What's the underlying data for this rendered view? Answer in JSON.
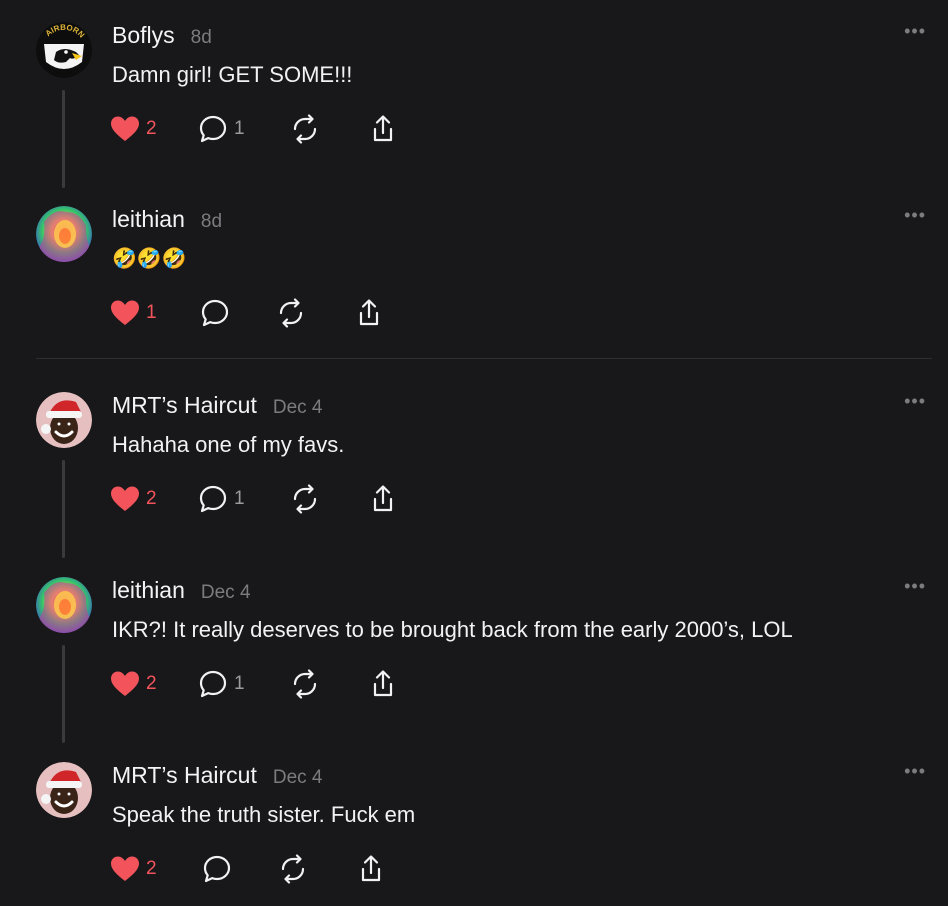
{
  "posts": [
    {
      "username": "Boflys",
      "time": "8d",
      "text": "Damn girl! GET SOME!!!",
      "likes": "2",
      "replies": "1",
      "avatar": "airborne-eagle-avatar",
      "avatar_text": "AIRBORNE"
    },
    {
      "username": "leithian",
      "time": "8d",
      "text": "🤣🤣🤣",
      "likes": "1",
      "replies": "",
      "avatar": "colorful-portrait-avatar"
    },
    {
      "username": "MRT’s Haircut",
      "time": "Dec 4",
      "text": "Hahaha one of my favs.",
      "likes": "2",
      "replies": "1",
      "avatar": "santa-hat-avatar"
    },
    {
      "username": "leithian",
      "time": "Dec 4",
      "text": "IKR?! It really deserves to be brought back from the early 2000’s, LOL",
      "likes": "2",
      "replies": "1",
      "avatar": "colorful-portrait-avatar"
    },
    {
      "username": "MRT’s Haircut",
      "time": "Dec 4",
      "text": "Speak the truth sister. Fuck em",
      "likes": "2",
      "replies": "",
      "avatar": "santa-hat-avatar"
    }
  ],
  "more_label": "•••",
  "colors": {
    "background": "#18181a",
    "like": "#f3545c",
    "muted": "#7b7b80"
  }
}
